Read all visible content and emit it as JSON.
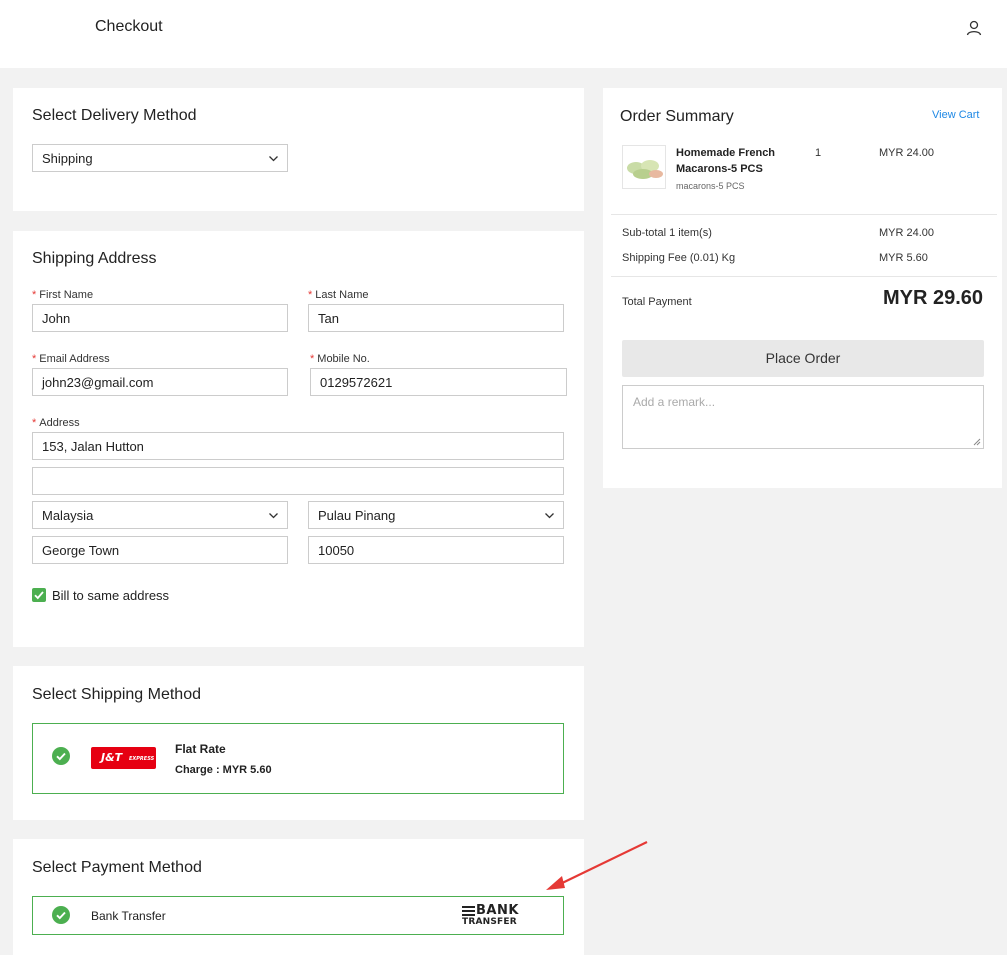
{
  "header": {
    "title": "Checkout",
    "user_icon": "user-icon"
  },
  "delivery": {
    "title": "Select Delivery Method",
    "method": "Shipping"
  },
  "shipping_address": {
    "title": "Shipping Address",
    "first_name_label": "First Name",
    "first_name": "John",
    "last_name_label": "Last Name",
    "last_name": "Tan",
    "email_label": "Email Address",
    "email": "john23@gmail.com",
    "mobile_label": "Mobile No.",
    "mobile": "0129572621",
    "address_label": "Address",
    "address_line1": "153, Jalan Hutton",
    "address_line2": "",
    "country": "Malaysia",
    "state": "Pulau Pinang",
    "city": "George Town",
    "postcode": "10050",
    "bill_same_label": "Bill to same address",
    "bill_same_checked": true,
    "required_mark": "*"
  },
  "shipping_method": {
    "title": "Select Shipping Method",
    "carrier_logo_text": "J&T",
    "carrier_logo_sub": "EXPRESS",
    "name": "Flat Rate",
    "charge": "Charge : MYR 5.60"
  },
  "payment_method": {
    "title": "Select Payment Method",
    "name": "Bank Transfer",
    "logo_line1": "BANK",
    "logo_line2": "TRANSFER"
  },
  "order_summary": {
    "title": "Order Summary",
    "view_cart": "View Cart",
    "item": {
      "name_line1": "Homemade French",
      "name_line2": "Macarons-5 PCS",
      "variant": "macarons-5 PCS",
      "qty": "1",
      "price": "MYR 24.00"
    },
    "subtotal_label": "Sub-total 1 item(s)",
    "subtotal_value": "MYR 24.00",
    "shipping_label": "Shipping Fee (0.01) Kg",
    "shipping_value": "MYR 5.60",
    "total_label": "Total Payment",
    "total_value": "MYR 29.60",
    "place_order": "Place Order",
    "remark_placeholder": "Add a remark..."
  },
  "colors": {
    "accent_green": "#4caf50",
    "required_red": "#e53935",
    "link_blue": "#1e88e5",
    "annotation_red": "#e53935"
  }
}
